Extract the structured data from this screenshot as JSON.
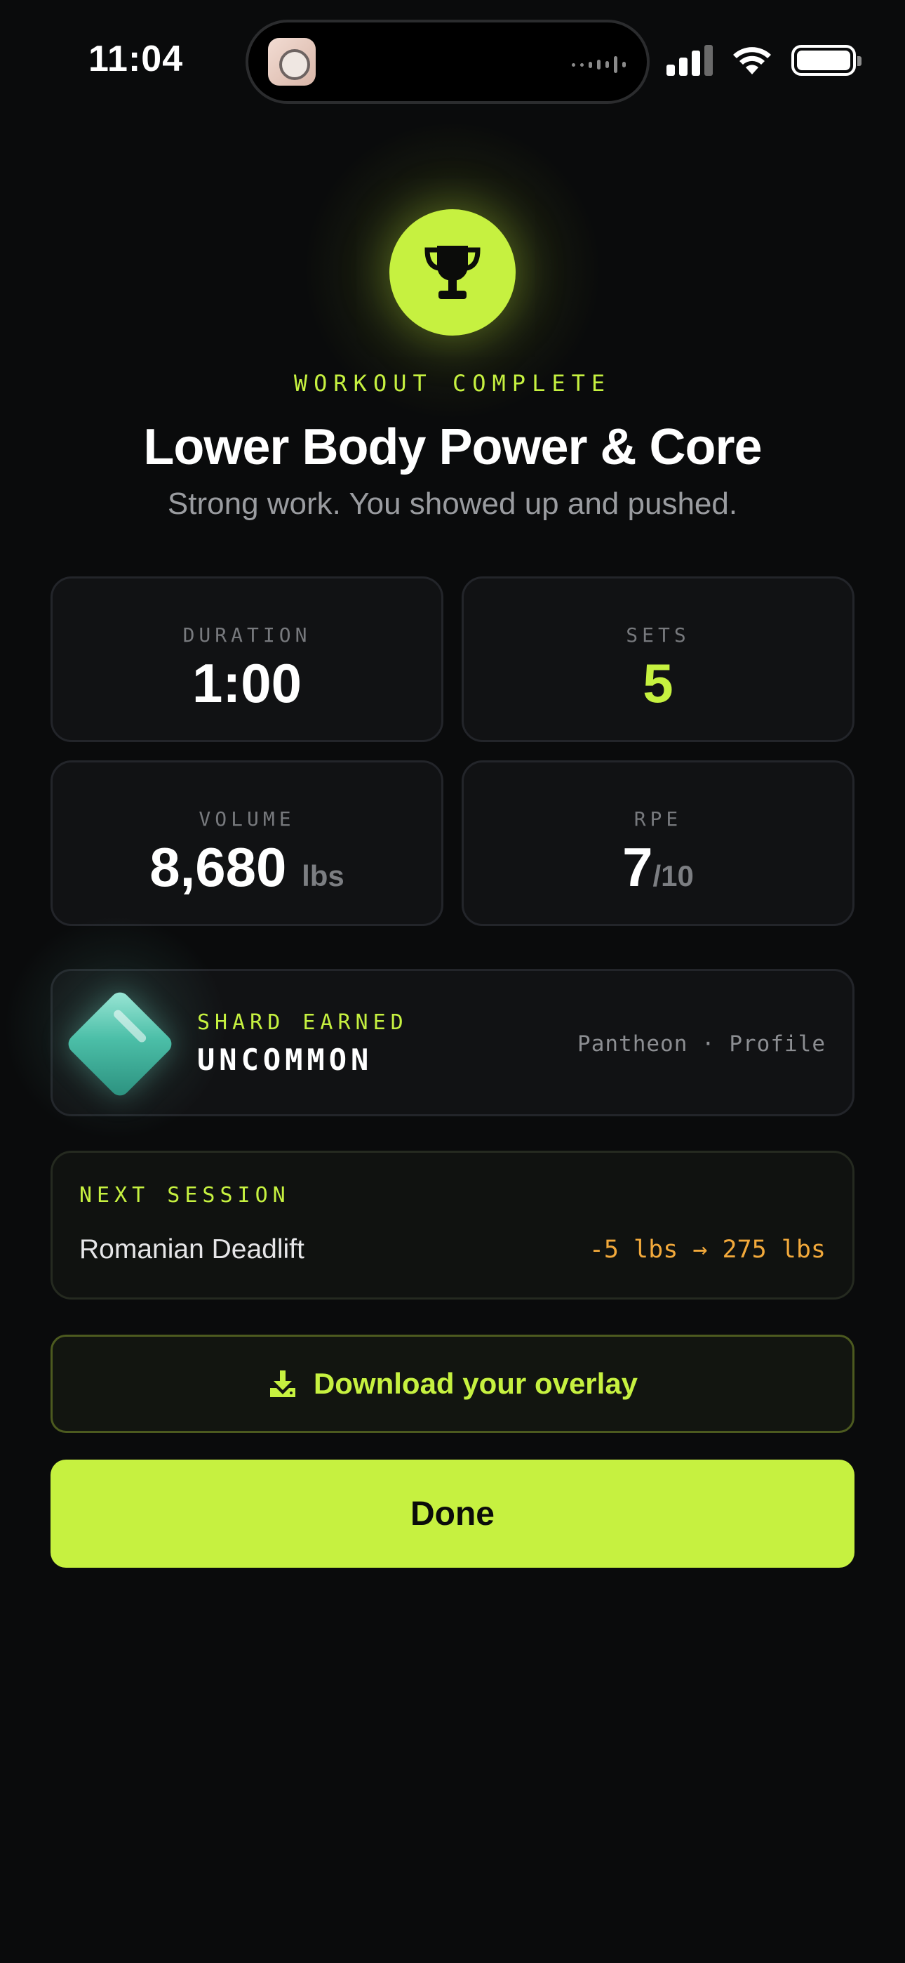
{
  "status_bar": {
    "time": "11:04"
  },
  "header": {
    "eyebrow": "WORKOUT COMPLETE",
    "title": "Lower Body Power & Core",
    "subtitle": "Strong work. You showed up and pushed."
  },
  "stats": {
    "duration": {
      "label": "DURATION",
      "value": "1:00"
    },
    "sets": {
      "label": "SETS",
      "value": "5"
    },
    "volume": {
      "label": "VOLUME",
      "value": "8,680",
      "unit": "lbs"
    },
    "rpe": {
      "label": "RPE",
      "value": "7",
      "unit": "/10"
    }
  },
  "shard": {
    "eyebrow": "SHARD EARNED",
    "rarity": "UNCOMMON",
    "link": "Pantheon · Profile"
  },
  "next_session": {
    "eyebrow": "NEXT SESSION",
    "exercise": "Romanian Deadlift",
    "change": "-5 lbs → 275 lbs"
  },
  "actions": {
    "overlay_label": "Download your overlay",
    "done_label": "Done"
  },
  "icons": {
    "trophy": "trophy-icon",
    "download": "download-icon",
    "shard": "gem-icon"
  },
  "colors": {
    "accent": "#c6f140",
    "background": "#0a0b0c",
    "warning": "#f2a93b",
    "gem": "#4cbfa8"
  }
}
